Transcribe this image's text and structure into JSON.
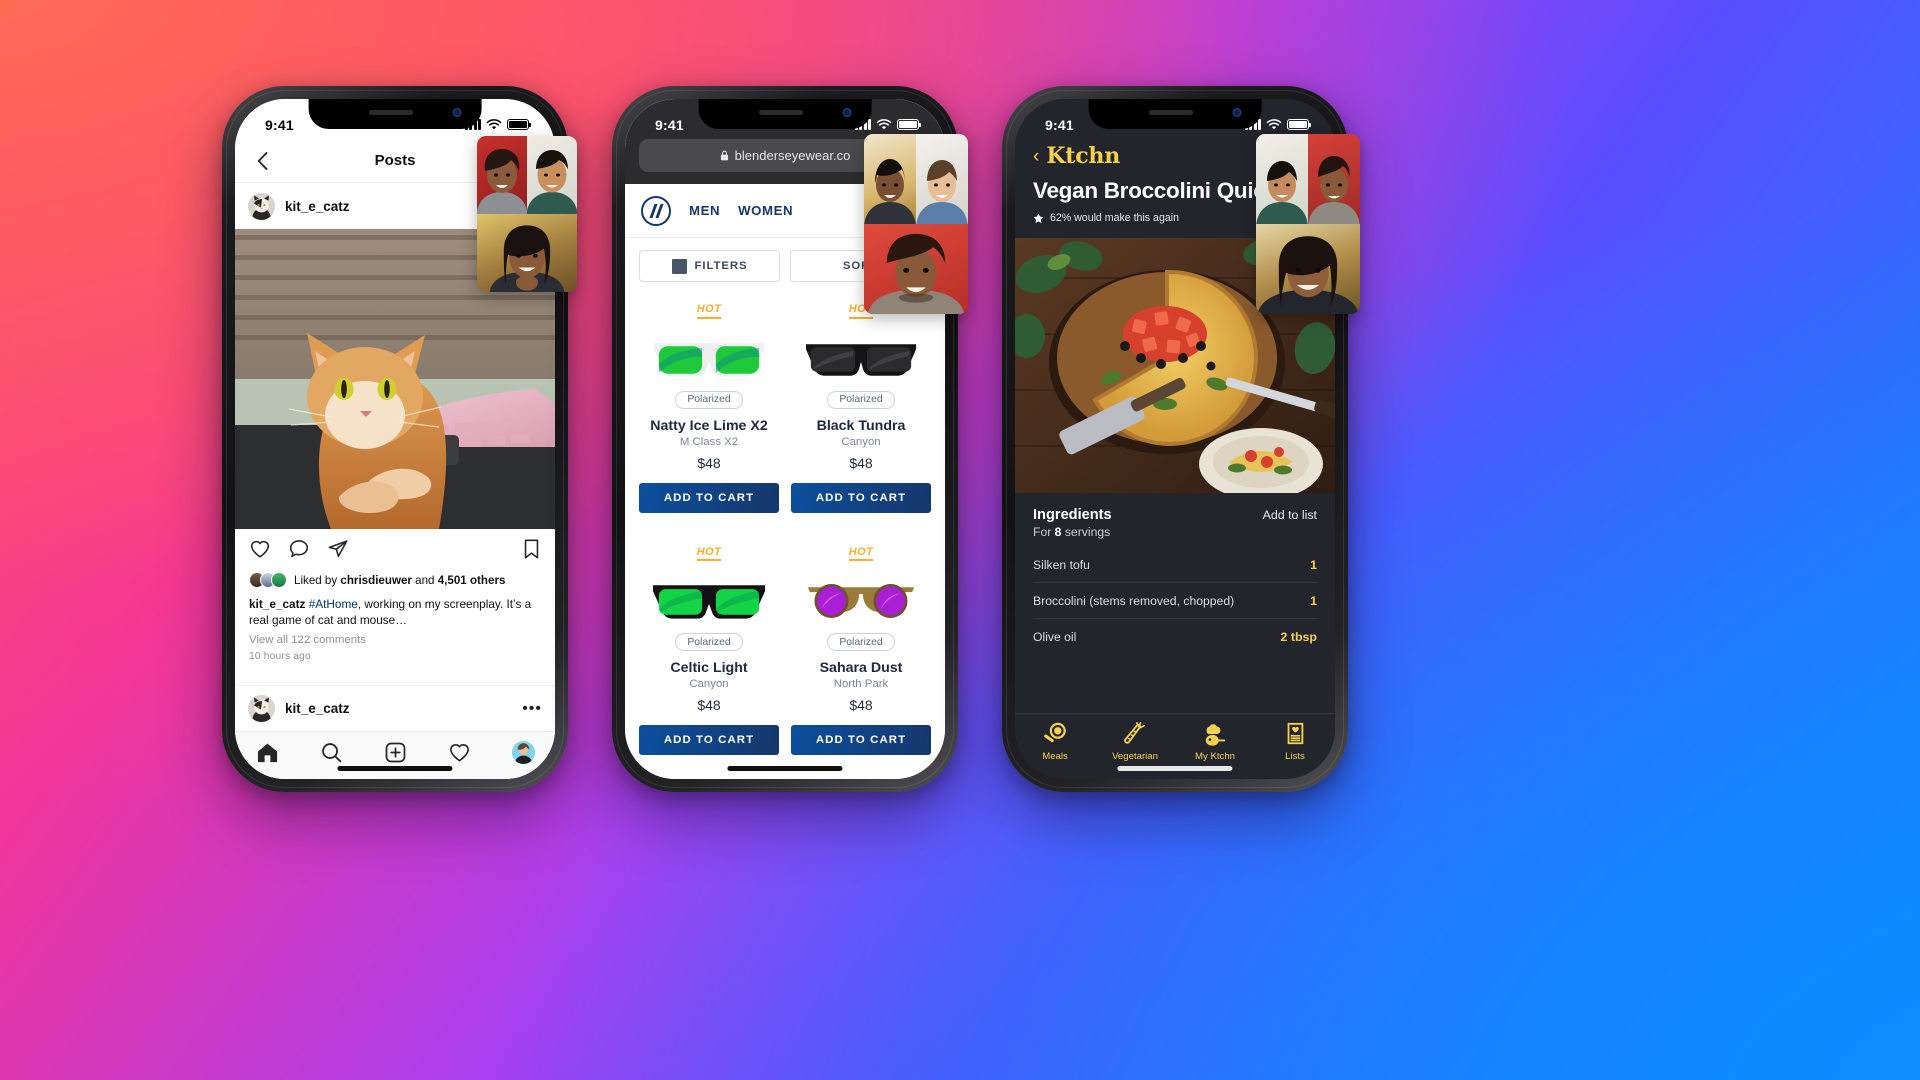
{
  "background": {
    "gradient_stops": [
      "#ff5a5f",
      "#f0359b",
      "#a93ff0",
      "#5b4dff",
      "#2f6dff",
      "#0d8bff"
    ]
  },
  "phone1": {
    "status": {
      "time": "9:41",
      "signal_icon": "cellular-bars-icon",
      "wifi_icon": "wifi-icon",
      "battery_icon": "battery-icon"
    },
    "nav": {
      "back_icon": "chevron-left-icon",
      "title": "Posts"
    },
    "post": {
      "username": "kit_e_catz",
      "avatar_icon": "cat-avatar",
      "photo_alt": "orange cat sitting at a pink laptop",
      "actions": {
        "like_icon": "heart-icon",
        "comment_icon": "comment-bubble-icon",
        "share_icon": "paper-plane-icon",
        "save_icon": "bookmark-icon"
      },
      "likes_prefix": "Liked by ",
      "likes_name": "chrisdieuwer",
      "likes_middle": " and ",
      "likes_count": "4,501 others",
      "caption_user": "kit_e_catz",
      "caption_tag": "#AtHome",
      "caption_text": ", working on my screenplay. It’s a real game of cat and mouse…",
      "view_comments": "View all 122 comments",
      "timestamp": "10 hours ago",
      "comment_user": "kit_e_catz",
      "more_icon": "ellipsis-icon"
    },
    "tabbar": [
      {
        "name": "home",
        "icon": "home-icon"
      },
      {
        "name": "search",
        "icon": "search-icon"
      },
      {
        "name": "create",
        "icon": "plus-square-icon"
      },
      {
        "name": "activity",
        "icon": "heart-icon"
      },
      {
        "name": "profile",
        "icon": "profile-avatar-icon"
      }
    ]
  },
  "phone2": {
    "status": {
      "time": "9:41"
    },
    "browser": {
      "lock_icon": "lock-icon",
      "url": "blenderseyewear.co"
    },
    "header": {
      "logo_icon": "blenders-slash-logo",
      "links": [
        "MEN",
        "WOMEN"
      ],
      "search_icon": "search-icon"
    },
    "filters": {
      "filters_label": "FILTERS",
      "filters_icon": "filter-square-icon",
      "sort_label": "SORT"
    },
    "products": [
      {
        "badge": "HOT",
        "tag": "Polarized",
        "name": "Natty Ice Lime X2",
        "collection": "M Class X2",
        "price": "$48",
        "cta": "ADD TO CART",
        "lens_color": "#2ad62a",
        "frame_color": "#f2f3f5",
        "style": "clear"
      },
      {
        "badge": "HOT",
        "tag": "Polarized",
        "name": "Black Tundra",
        "collection": "Canyon",
        "price": "$48",
        "cta": "ADD TO CART",
        "lens_color": "#2a2a2c",
        "frame_color": "#131314",
        "style": "black"
      },
      {
        "badge": "HOT",
        "tag": "Polarized",
        "name": "Celtic Light",
        "collection": "Canyon",
        "price": "$48",
        "cta": "ADD TO CART",
        "lens_color": "#16d94a",
        "frame_color": "#121214",
        "style": "black"
      },
      {
        "badge": "HOT",
        "tag": "Polarized",
        "name": "Sahara Dust",
        "collection": "North Park",
        "price": "$48",
        "cta": "ADD TO CART",
        "lens_color": "#a81fd4",
        "frame_color": "#9a7b3a",
        "style": "round"
      }
    ]
  },
  "phone3": {
    "status": {
      "time": "9:41"
    },
    "header": {
      "back_icon": "chevron-left-icon",
      "brand": "Ktchn",
      "title": "Vegan Broccolini Quiche",
      "star_icon": "star-icon",
      "rating": "62% would make this again"
    },
    "hero_alt": "vegan broccolini quiche on a wooden table",
    "ingredients": {
      "heading": "Ingredients",
      "add_to_list": "Add to list",
      "servings_prefix": "For ",
      "servings_count": "8",
      "servings_suffix": " servings",
      "items": [
        {
          "name": "Silken tofu",
          "amount": "1"
        },
        {
          "name": "Broccolini (stems removed, chopped)",
          "amount": "1"
        },
        {
          "name": "Olive oil",
          "amount": "2 tbsp"
        }
      ]
    },
    "tabs": [
      {
        "label": "Meals",
        "icon": "pan-search-icon"
      },
      {
        "label": "Vegetarian",
        "icon": "carrot-icon"
      },
      {
        "label": "My Ktchn",
        "icon": "chef-hat-icon"
      },
      {
        "label": "Lists",
        "icon": "list-heart-icon"
      }
    ],
    "accent_color": "#f5d14b"
  },
  "video_call": {
    "phone1_tiles": [
      "participant-1",
      "participant-2",
      "participant-3"
    ],
    "phone2_tiles": [
      "participant-1",
      "participant-2",
      "participant-3"
    ],
    "phone3_tiles": [
      "participant-1",
      "participant-2",
      "participant-3"
    ]
  }
}
